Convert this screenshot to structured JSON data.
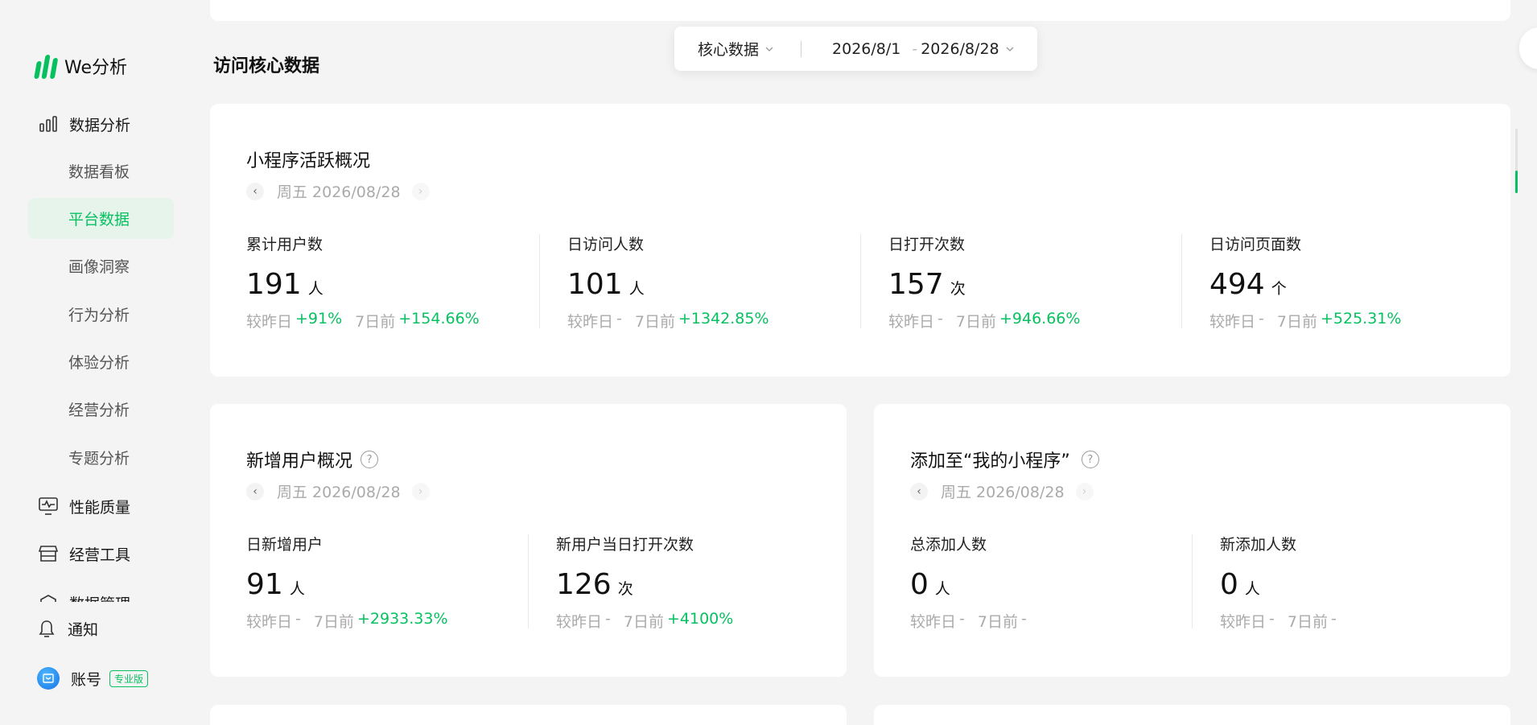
{
  "brand": {
    "name": "We分析",
    "color": "#07c160"
  },
  "sidebar": {
    "group_data_analysis": "数据分析",
    "sub_items": [
      {
        "label": "数据看板",
        "active": false
      },
      {
        "label": "平台数据",
        "active": true
      },
      {
        "label": "画像洞察",
        "active": false
      },
      {
        "label": "行为分析",
        "active": false
      },
      {
        "label": "体验分析",
        "active": false
      },
      {
        "label": "经营分析",
        "active": false
      },
      {
        "label": "专题分析",
        "active": false
      }
    ],
    "group_performance": "性能质量",
    "group_tools": "经营工具",
    "group_data_manage": "数据管理",
    "notify": "通知",
    "account": "账号",
    "account_badge": "专业版"
  },
  "page": {
    "section_title": "访问核心数据"
  },
  "filter": {
    "category": "核心数据",
    "date_start": "2026/8/1",
    "date_sep": "-",
    "date_end": "2026/8/28"
  },
  "active_overview": {
    "title": "小程序活跃概况",
    "date": "周五 2026/08/28",
    "metrics": [
      {
        "label": "累计用户数",
        "value": "191",
        "unit": "人",
        "cmp_day_label": "较昨日",
        "cmp_day": "+91%",
        "cmp_week_label": "7日前",
        "cmp_week": "+154.66%"
      },
      {
        "label": "日访问人数",
        "value": "101",
        "unit": "人",
        "cmp_day_label": "较昨日",
        "cmp_day": "-",
        "cmp_week_label": "7日前",
        "cmp_week": "+1342.85%"
      },
      {
        "label": "日打开次数",
        "value": "157",
        "unit": "次",
        "cmp_day_label": "较昨日",
        "cmp_day": "-",
        "cmp_week_label": "7日前",
        "cmp_week": "+946.66%"
      },
      {
        "label": "日访问页面数",
        "value": "494",
        "unit": "个",
        "cmp_day_label": "较昨日",
        "cmp_day": "-",
        "cmp_week_label": "7日前",
        "cmp_week": "+525.31%"
      }
    ]
  },
  "new_users": {
    "title": "新增用户概况",
    "date": "周五 2026/08/28",
    "metrics": [
      {
        "label": "日新增用户",
        "value": "91",
        "unit": "人",
        "cmp_day_label": "较昨日",
        "cmp_day": "-",
        "cmp_week_label": "7日前",
        "cmp_week": "+2933.33%"
      },
      {
        "label": "新用户当日打开次数",
        "value": "126",
        "unit": "次",
        "cmp_day_label": "较昨日",
        "cmp_day": "-",
        "cmp_week_label": "7日前",
        "cmp_week": "+4100%"
      }
    ]
  },
  "my_miniprogram": {
    "title": "添加至“我的小程序”",
    "date": "周五 2026/08/28",
    "metrics": [
      {
        "label": "总添加人数",
        "value": "0",
        "unit": "人",
        "cmp_day_label": "较昨日",
        "cmp_day": "-",
        "cmp_week_label": "7日前",
        "cmp_week": "-"
      },
      {
        "label": "新添加人数",
        "value": "0",
        "unit": "人",
        "cmp_day_label": "较昨日",
        "cmp_day": "-",
        "cmp_week_label": "7日前",
        "cmp_week": "-"
      }
    ]
  }
}
